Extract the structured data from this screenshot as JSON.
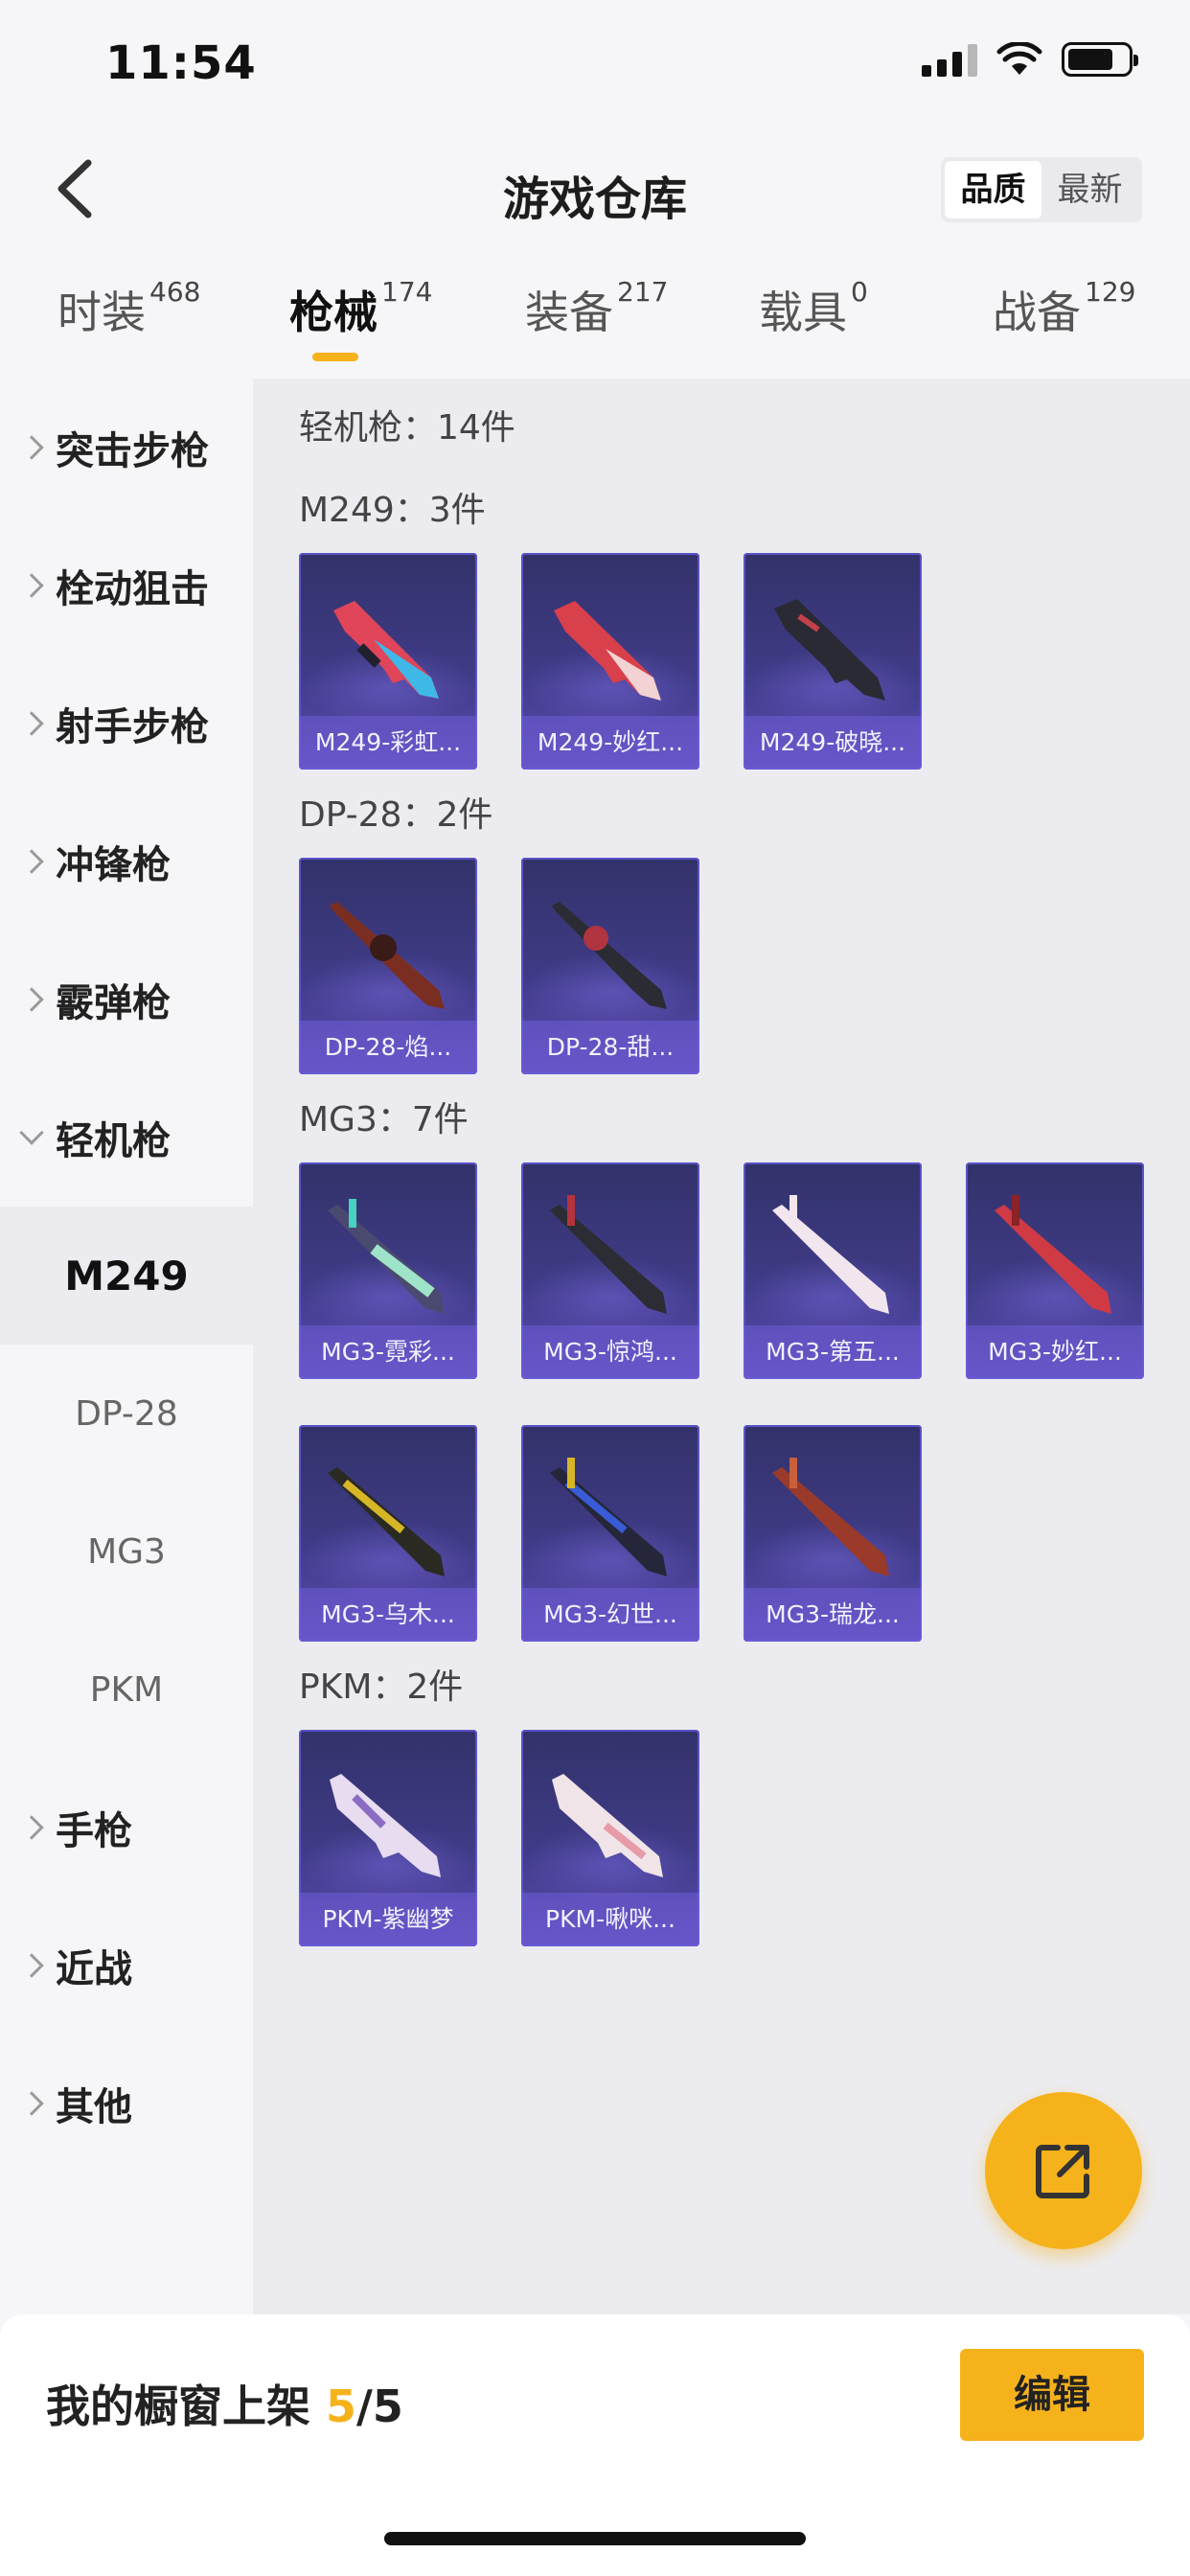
{
  "status_bar": {
    "time": "11:54"
  },
  "header": {
    "title": "游戏仓库",
    "sort_options": [
      "品质",
      "最新"
    ],
    "sort_active": "品质"
  },
  "tabs": [
    {
      "label": "时装",
      "count": "468",
      "active": false
    },
    {
      "label": "枪械",
      "count": "174",
      "active": true
    },
    {
      "label": "装备",
      "count": "217",
      "active": false
    },
    {
      "label": "载具",
      "count": "0",
      "active": false
    },
    {
      "label": "战备",
      "count": "129",
      "active": false
    }
  ],
  "sidebar": {
    "categories": [
      "突击步枪",
      "栓动狙击",
      "射手步枪",
      "冲锋枪",
      "霰弹枪",
      "轻机枪",
      "手枪",
      "近战",
      "其他"
    ],
    "expanded": "轻机枪",
    "subitems": [
      "M249",
      "DP-28",
      "MG3",
      "PKM"
    ],
    "active_sub": "M249"
  },
  "content": {
    "group_title": "轻机枪：14件",
    "sections": [
      {
        "title": "M249：3件",
        "items": [
          "M249-彩虹...",
          "M249-妙红...",
          "M249-破晓..."
        ]
      },
      {
        "title": "DP-28：2件",
        "items": [
          "DP-28-焰...",
          "DP-28-甜..."
        ]
      },
      {
        "title": "MG3：7件",
        "items": [
          "MG3-霓彩...",
          "MG3-惊鸿...",
          "MG3-第五...",
          "MG3-妙红...",
          "MG3-乌木...",
          "MG3-幻世...",
          "MG3-瑞龙..."
        ]
      },
      {
        "title": "PKM：2件",
        "items": [
          "PKM-紫幽梦",
          "PKM-啾咪..."
        ]
      }
    ]
  },
  "bottom_bar": {
    "showcase_label": "我的橱窗上架",
    "showcase_current": "5",
    "showcase_total": "/5",
    "edit_label": "编辑"
  },
  "icons": [
    "back-arrow-icon",
    "signal-icon",
    "wifi-icon",
    "battery-icon",
    "share-external-icon",
    "chevron-right-icon",
    "chevron-down-icon"
  ],
  "colors": {
    "accent": "#f6b21b",
    "card_bg": "#3f3b86",
    "card_border": "#5b52c8"
  }
}
